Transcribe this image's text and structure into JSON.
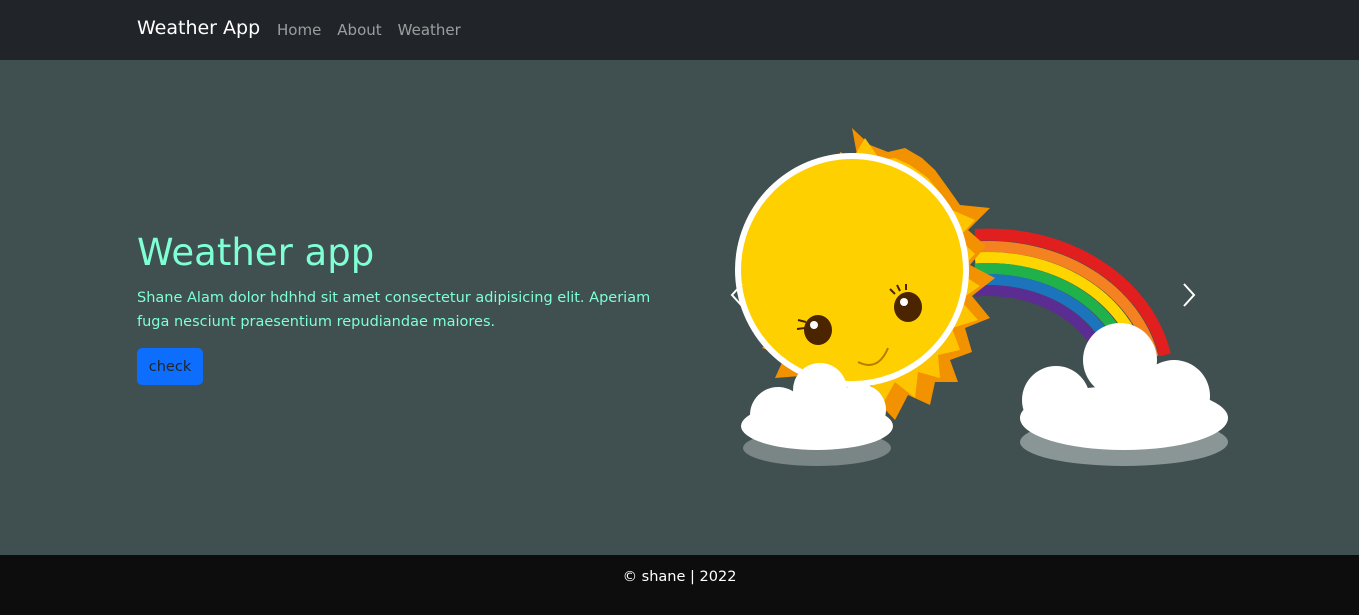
{
  "navbar": {
    "brand": "Weather App",
    "links": [
      "Home",
      "About",
      "Weather"
    ]
  },
  "hero": {
    "title": "Weather app",
    "text": "Shane Alam dolor hdhhd sit amet consectetur adipisicing elit. Aperiam fuga nesciunt praesentium repudiandae maiores.",
    "button_label": "check"
  },
  "carousel": {
    "slide_image": "sun-rainbow-clouds-illustration",
    "prev_icon": "chevron-left-icon",
    "next_icon": "chevron-right-icon"
  },
  "footer": {
    "text": "© shane | 2022"
  },
  "colors": {
    "navbar_bg": "#212529",
    "hero_bg": "#404f4f",
    "accent_text": "#7fffd4",
    "button_bg": "#0d6efd",
    "footer_bg": "#0d0d0d"
  }
}
